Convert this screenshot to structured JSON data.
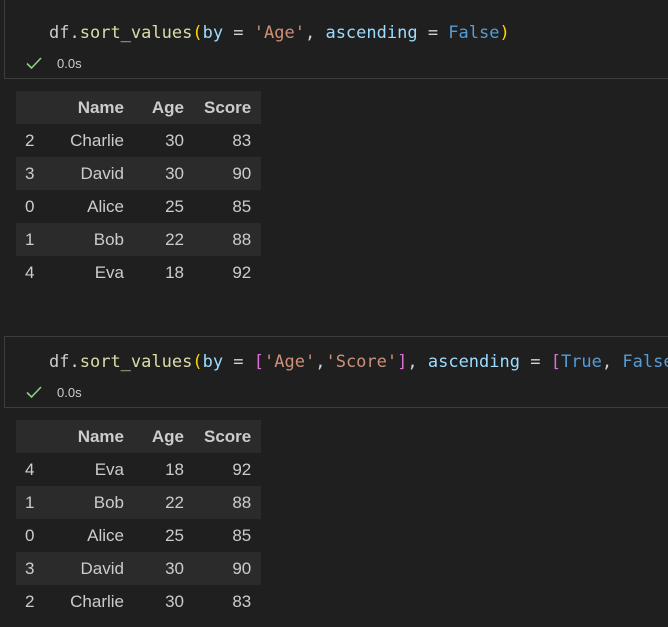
{
  "cells": [
    {
      "code": {
        "obj": "df",
        "dot": ".",
        "fn": "sort_values",
        "open": "(",
        "p1": "by",
        "eq1": " = ",
        "lb": "",
        "s1": "'Age'",
        "comma_s": "",
        "s2": "",
        "rb": "",
        "sep": ", ",
        "p2": "ascending",
        "eq2": " = ",
        "vlb": "",
        "v1": "False",
        "vsep": "",
        "v2": "",
        "vrb": "",
        "close": ")"
      },
      "status": {
        "icon": "check-icon",
        "time": "0.0s"
      },
      "table": {
        "columns": [
          "",
          "Name",
          "Age",
          "Score"
        ],
        "rows": [
          [
            "2",
            "Charlie",
            "30",
            "83"
          ],
          [
            "3",
            "David",
            "30",
            "90"
          ],
          [
            "0",
            "Alice",
            "25",
            "85"
          ],
          [
            "1",
            "Bob",
            "22",
            "88"
          ],
          [
            "4",
            "Eva",
            "18",
            "92"
          ]
        ]
      }
    },
    {
      "code": {
        "obj": "df",
        "dot": ".",
        "fn": "sort_values",
        "open": "(",
        "p1": "by",
        "eq1": " = ",
        "lb": "[",
        "s1": "'Age'",
        "comma_s": ",",
        "s2": "'Score'",
        "rb": "]",
        "sep": ", ",
        "p2": "ascending",
        "eq2": " = ",
        "vlb": "[",
        "v1": "True",
        "vsep": ", ",
        "v2": "False",
        "vrb": "]",
        "close": ")"
      },
      "status": {
        "icon": "check-icon",
        "time": "0.0s"
      },
      "table": {
        "columns": [
          "",
          "Name",
          "Age",
          "Score"
        ],
        "rows": [
          [
            "4",
            "Eva",
            "18",
            "92"
          ],
          [
            "1",
            "Bob",
            "22",
            "88"
          ],
          [
            "0",
            "Alice",
            "25",
            "85"
          ],
          [
            "3",
            "David",
            "30",
            "90"
          ],
          [
            "2",
            "Charlie",
            "30",
            "83"
          ]
        ]
      }
    }
  ],
  "colors": {
    "background": "#1f1f1f",
    "success": "#89d185",
    "function": "#dcdcaa",
    "parameter": "#9cdcfe",
    "string": "#ce9178",
    "keyword": "#569cd6"
  }
}
